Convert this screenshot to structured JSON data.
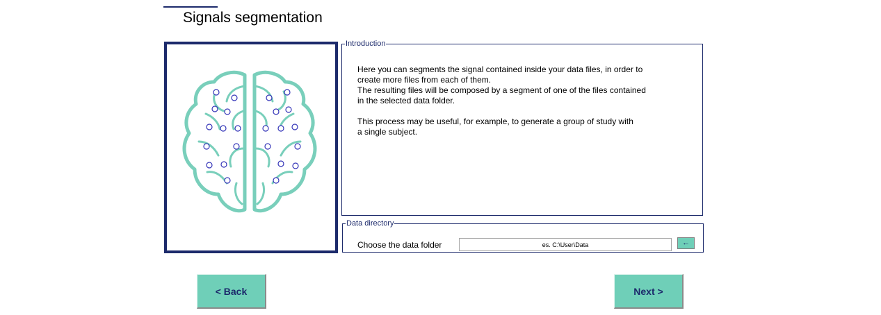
{
  "page_title": "Signals segmentation",
  "image": {
    "icon": "brain-electrodes-icon"
  },
  "introduction": {
    "legend": "Introduction",
    "paragraph1": [
      "Here you can segments the signal contained inside your data files, in order to",
      "create more files from each of them.",
      "The resulting files will be composed by a segment of one of the files contained",
      "in the selected data folder."
    ],
    "paragraph2": [
      "This process may be useful, for example, to generate a group of study with",
      "a single subject."
    ]
  },
  "data_directory": {
    "legend": "Data directory",
    "label": "Choose the data folder",
    "placeholder": "es. C:\\User\\Data",
    "browse_label": "←"
  },
  "navigation": {
    "back_label": "<  Back",
    "next_label": "Next  >"
  },
  "colors": {
    "accent": "#6fcfb8",
    "navy": "#1c2a6b",
    "brain": "#79cfbb",
    "electrode": "#3434b8"
  }
}
